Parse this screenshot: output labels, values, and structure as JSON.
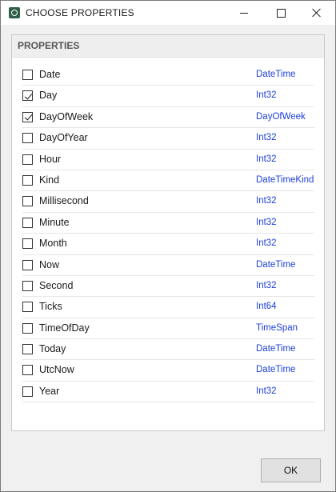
{
  "window": {
    "title": "CHOOSE PROPERTIES"
  },
  "panel": {
    "header": "PROPERTIES",
    "properties": [
      {
        "name": "Date",
        "type": "DateTime",
        "checked": false
      },
      {
        "name": "Day",
        "type": "Int32",
        "checked": true
      },
      {
        "name": "DayOfWeek",
        "type": "DayOfWeek",
        "checked": true
      },
      {
        "name": "DayOfYear",
        "type": "Int32",
        "checked": false
      },
      {
        "name": "Hour",
        "type": "Int32",
        "checked": false
      },
      {
        "name": "Kind",
        "type": "DateTimeKind",
        "checked": false
      },
      {
        "name": "Millisecond",
        "type": "Int32",
        "checked": false
      },
      {
        "name": "Minute",
        "type": "Int32",
        "checked": false
      },
      {
        "name": "Month",
        "type": "Int32",
        "checked": false
      },
      {
        "name": "Now",
        "type": "DateTime",
        "checked": false
      },
      {
        "name": "Second",
        "type": "Int32",
        "checked": false
      },
      {
        "name": "Ticks",
        "type": "Int64",
        "checked": false
      },
      {
        "name": "TimeOfDay",
        "type": "TimeSpan",
        "checked": false
      },
      {
        "name": "Today",
        "type": "DateTime",
        "checked": false
      },
      {
        "name": "UtcNow",
        "type": "DateTime",
        "checked": false
      },
      {
        "name": "Year",
        "type": "Int32",
        "checked": false
      }
    ]
  },
  "footer": {
    "ok_label": "OK"
  },
  "colors": {
    "type_text": "#1e40d8",
    "app_icon": "#2f5f49"
  }
}
